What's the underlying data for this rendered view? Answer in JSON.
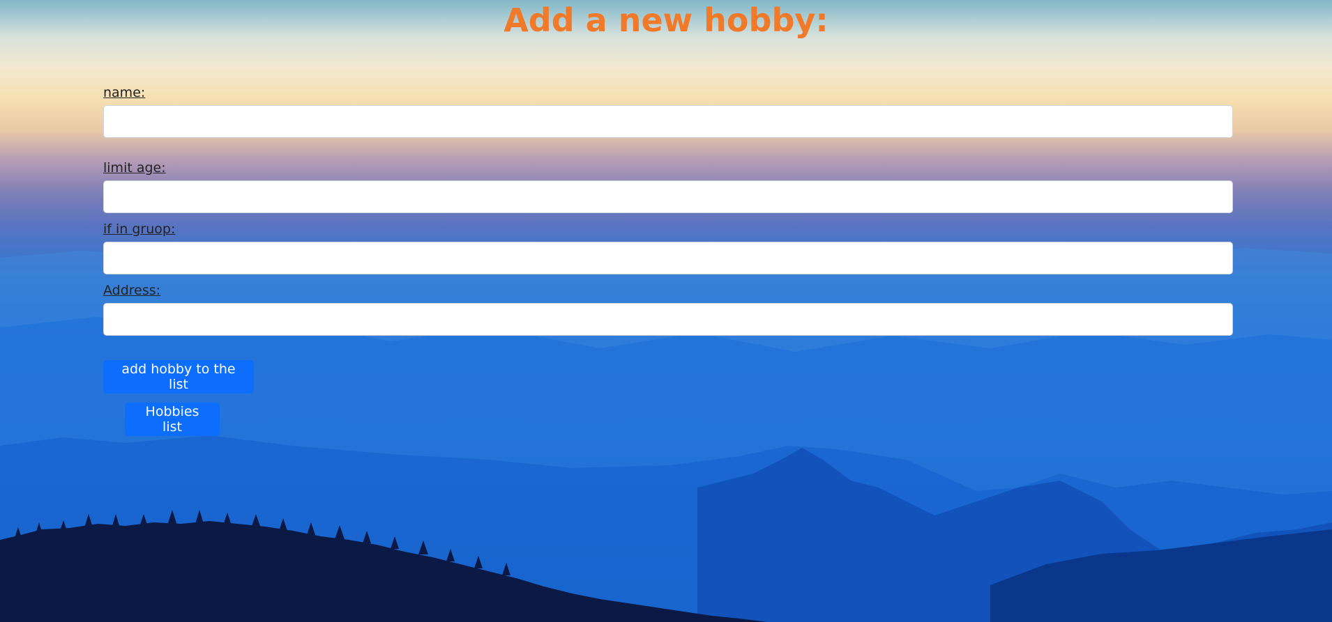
{
  "page": {
    "title": "Add a new hobby:"
  },
  "form": {
    "name_label": "name:",
    "name_value": "",
    "limit_age_label": "limit age:",
    "limit_age_value": "",
    "group_label": "if in gruop:",
    "group_value": "",
    "address_label": "Address:",
    "address_value": ""
  },
  "buttons": {
    "add_label": "add hobby to the list",
    "list_label": "Hobbies list"
  },
  "colors": {
    "title": "#f07a2a",
    "button": "#0d6efd"
  }
}
